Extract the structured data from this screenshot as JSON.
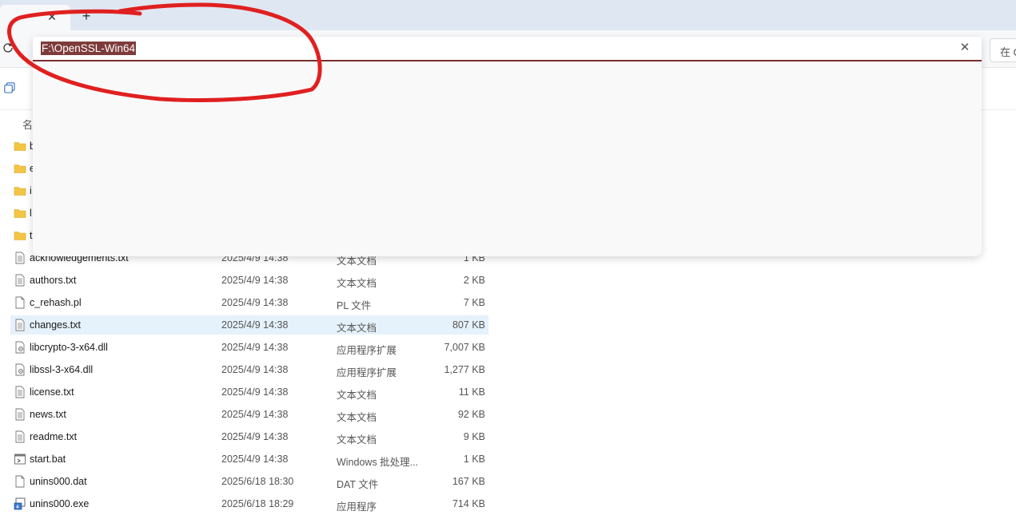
{
  "tab": {
    "close_glyph": "✕",
    "new_tab_glyph": "+"
  },
  "toolbar": {
    "refresh_icon": "refresh-icon",
    "search_placeholder": "在 O"
  },
  "cmdbar": {
    "copy_icon": "copy-icon"
  },
  "address": {
    "value": "F:\\OpenSSL-Win64",
    "clear_glyph": "✕",
    "highlight_color": "#7e3b3b"
  },
  "column_header": {
    "name": "名"
  },
  "folders": [
    {
      "name": "b"
    },
    {
      "name": "e"
    },
    {
      "name": "i"
    },
    {
      "name": "l"
    },
    {
      "name": "t"
    }
  ],
  "files": [
    {
      "name": "acknowledgements.txt",
      "date": "2025/4/9 14:38",
      "type": "文本文档",
      "size": "1 KB",
      "icon": "text-file-icon"
    },
    {
      "name": "authors.txt",
      "date": "2025/4/9 14:38",
      "type": "文本文档",
      "size": "2 KB",
      "icon": "text-file-icon"
    },
    {
      "name": "c_rehash.pl",
      "date": "2025/4/9 14:38",
      "type": "PL 文件",
      "size": "7 KB",
      "icon": "blank-file-icon"
    },
    {
      "name": "changes.txt",
      "date": "2025/4/9 14:38",
      "type": "文本文档",
      "size": "807 KB",
      "icon": "text-file-icon",
      "selected": true
    },
    {
      "name": "libcrypto-3-x64.dll",
      "date": "2025/4/9 14:38",
      "type": "应用程序扩展",
      "size": "7,007 KB",
      "icon": "dll-file-icon"
    },
    {
      "name": "libssl-3-x64.dll",
      "date": "2025/4/9 14:38",
      "type": "应用程序扩展",
      "size": "1,277 KB",
      "icon": "dll-file-icon"
    },
    {
      "name": "license.txt",
      "date": "2025/4/9 14:38",
      "type": "文本文档",
      "size": "11 KB",
      "icon": "text-file-icon"
    },
    {
      "name": "news.txt",
      "date": "2025/4/9 14:38",
      "type": "文本文档",
      "size": "92 KB",
      "icon": "text-file-icon"
    },
    {
      "name": "readme.txt",
      "date": "2025/4/9 14:38",
      "type": "文本文档",
      "size": "9 KB",
      "icon": "text-file-icon"
    },
    {
      "name": "start.bat",
      "date": "2025/4/9 14:38",
      "type": "Windows 批处理...",
      "size": "1 KB",
      "icon": "batch-file-icon"
    },
    {
      "name": "unins000.dat",
      "date": "2025/6/18 18:30",
      "type": "DAT 文件",
      "size": "167 KB",
      "icon": "blank-file-icon"
    },
    {
      "name": "unins000.exe",
      "date": "2025/6/18 18:29",
      "type": "应用程序",
      "size": "714 KB",
      "icon": "installer-icon"
    }
  ],
  "colors": {
    "tabstrip": "#dfe7f2",
    "selected_row": "#e5f1fb",
    "folder": "#f4c545",
    "annotation": "#e02020"
  }
}
